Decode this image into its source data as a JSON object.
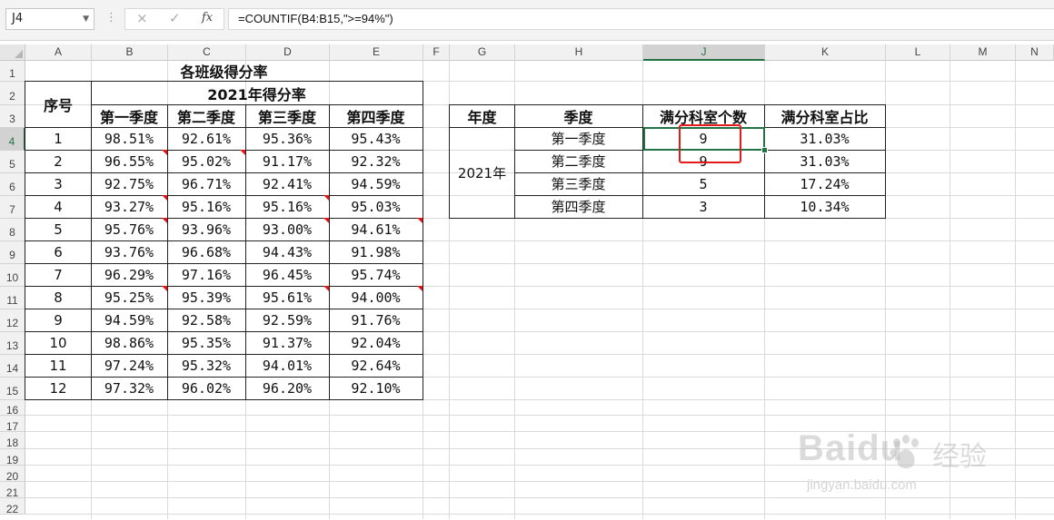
{
  "namebox": {
    "value": "J4"
  },
  "formula_bar": {
    "cancel_icon": "×",
    "enter_icon": "✓",
    "fx_label": "fx",
    "formula": "=COUNTIF(B4:B15,\">=94%\")"
  },
  "columns": [
    "A",
    "B",
    "C",
    "D",
    "E",
    "F",
    "G",
    "H",
    "J",
    "K",
    "L",
    "M",
    "N"
  ],
  "rows": [
    "1",
    "2",
    "3",
    "4",
    "5",
    "6",
    "7",
    "8",
    "9",
    "10",
    "11",
    "12",
    "13",
    "14",
    "15",
    "16",
    "17",
    "18",
    "19",
    "20",
    "21",
    "22"
  ],
  "table1": {
    "title": "各班级得分率",
    "col_a_header": "序号",
    "subtitle": "2021年得分率",
    "quarter_headers": [
      "第一季度",
      "第二季度",
      "第三季度",
      "第四季度"
    ],
    "rows": [
      [
        "1",
        "98.51%",
        "92.61%",
        "95.36%",
        "95.43%"
      ],
      [
        "2",
        "96.55%",
        "95.02%",
        "91.17%",
        "92.32%"
      ],
      [
        "3",
        "92.75%",
        "96.71%",
        "92.41%",
        "94.59%"
      ],
      [
        "4",
        "93.27%",
        "95.16%",
        "95.16%",
        "95.03%"
      ],
      [
        "5",
        "95.76%",
        "93.96%",
        "93.00%",
        "94.61%"
      ],
      [
        "6",
        "93.76%",
        "96.68%",
        "94.43%",
        "91.98%"
      ],
      [
        "7",
        "96.29%",
        "97.16%",
        "96.45%",
        "95.74%"
      ],
      [
        "8",
        "95.25%",
        "95.39%",
        "95.61%",
        "94.00%"
      ],
      [
        "9",
        "94.59%",
        "92.58%",
        "92.59%",
        "91.76%"
      ],
      [
        "10",
        "98.86%",
        "95.35%",
        "91.37%",
        "92.04%"
      ],
      [
        "11",
        "97.24%",
        "95.32%",
        "94.01%",
        "92.64%"
      ],
      [
        "12",
        "97.32%",
        "96.02%",
        "96.20%",
        "92.10%"
      ]
    ]
  },
  "table2": {
    "headers": [
      "年度",
      "季度",
      "满分科室个数",
      "满分科室占比"
    ],
    "year": "2021年",
    "rows": [
      [
        "第一季度",
        "9",
        "31.03%"
      ],
      [
        "第二季度",
        "9",
        "31.03%"
      ],
      [
        "第三季度",
        "5",
        "17.24%"
      ],
      [
        "第四季度",
        "3",
        "10.34%"
      ]
    ]
  },
  "watermark": {
    "brand": "Baidu",
    "cn": "经验",
    "url": "jingyan.baidu.com"
  },
  "colors": {
    "accent": "#217346",
    "highlight": "#e21a1a"
  }
}
